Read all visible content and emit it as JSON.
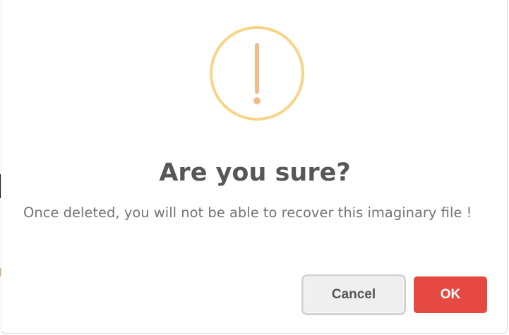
{
  "dialog": {
    "title": "Are you sure?",
    "message": "Once deleted, you will not be able to recover this imaginary file !",
    "icon": "warning-exclamation-icon",
    "buttons": {
      "cancel_label": "Cancel",
      "ok_label": "OK"
    }
  },
  "colors": {
    "icon_ring": "#f8d486",
    "icon_mark": "#f4bb87",
    "title": "#575757",
    "message": "#747474",
    "cancel_bg": "#efefef",
    "ok_bg": "#e64942"
  }
}
